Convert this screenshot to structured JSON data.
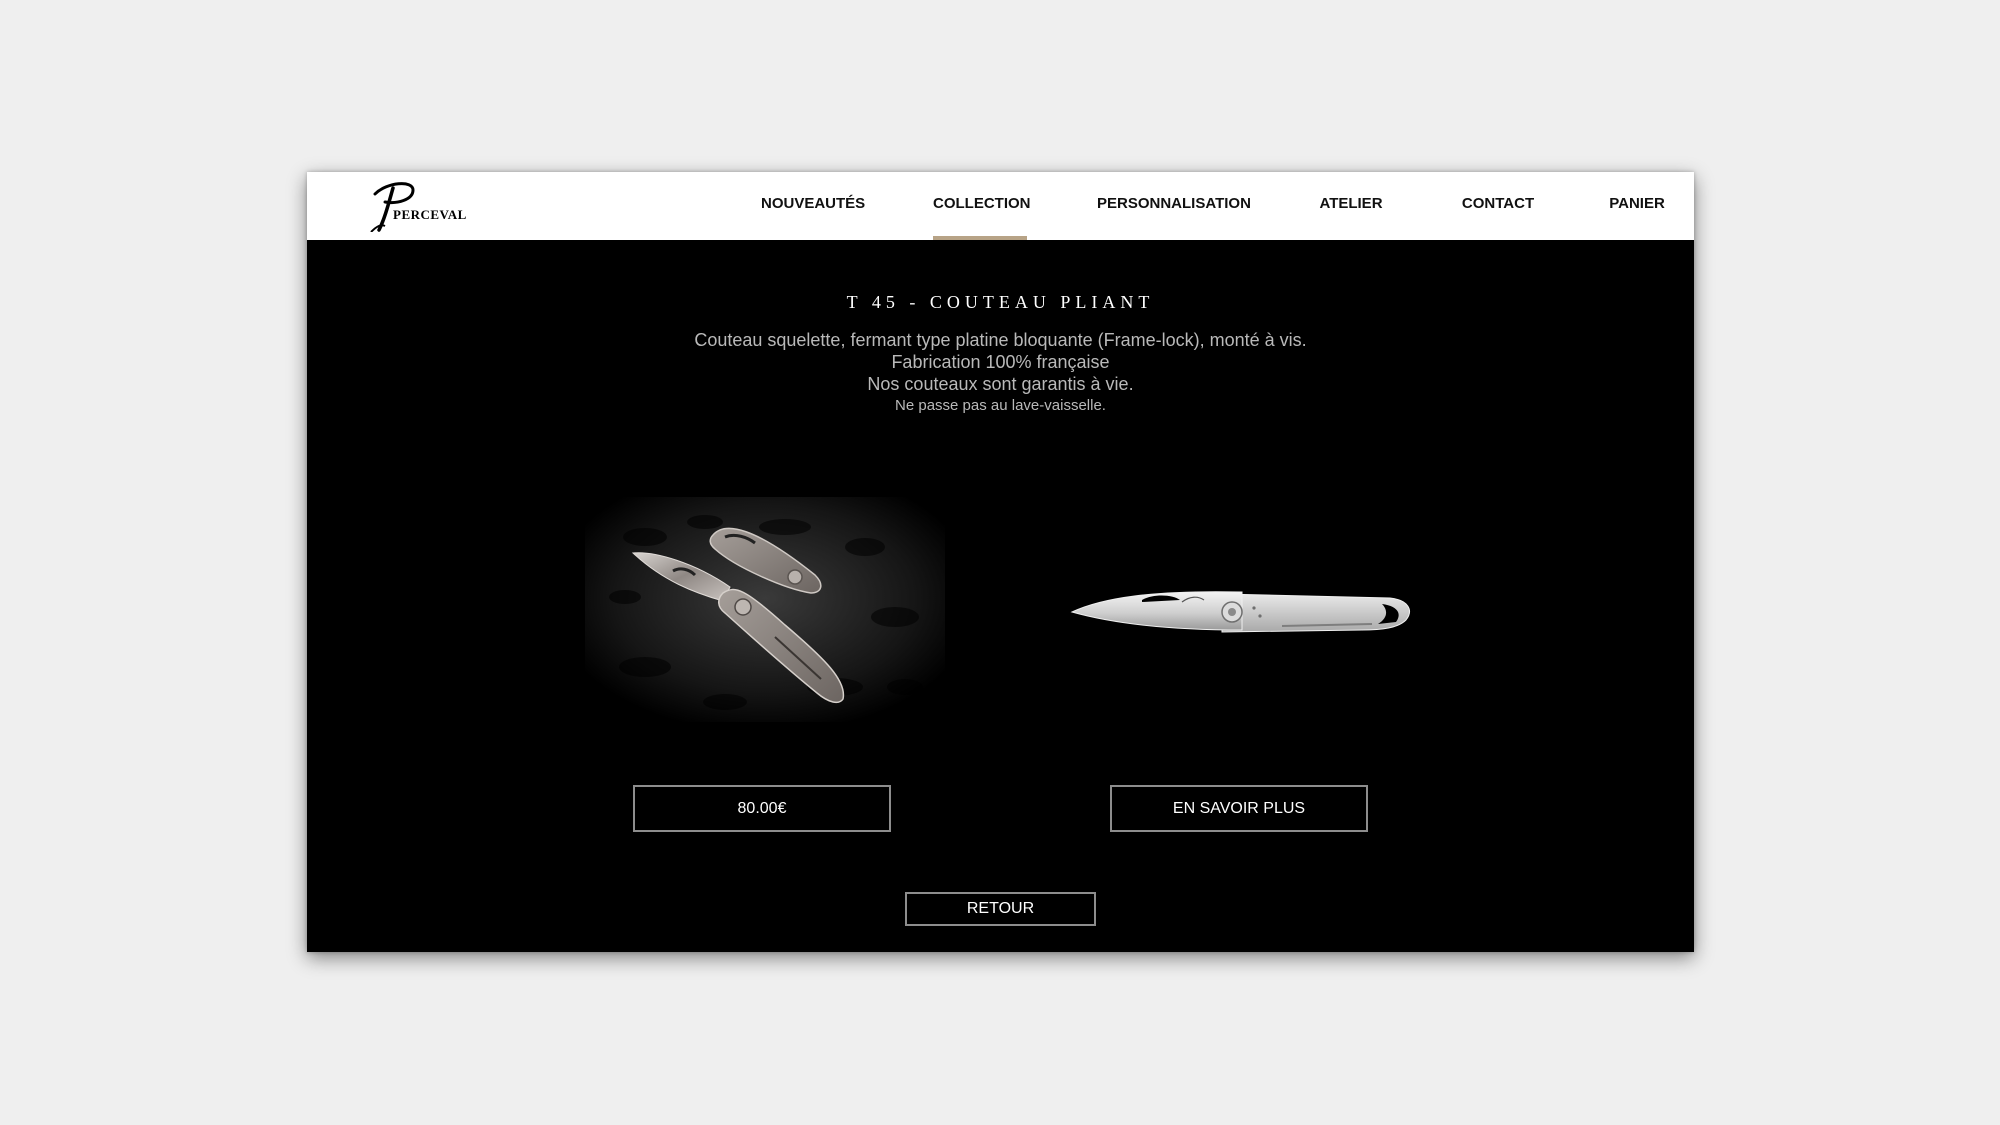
{
  "brand": {
    "logo_text": "PERCEVAL"
  },
  "nav": {
    "items": [
      {
        "label": "NOUVEAUTÉS"
      },
      {
        "label": "COLLECTION"
      },
      {
        "label": "PERSONNALISATION"
      },
      {
        "label": "ATELIER"
      },
      {
        "label": "CONTACT"
      },
      {
        "label": "PANIER"
      }
    ],
    "active": "COLLECTION",
    "accent_color": "#b7a386"
  },
  "product": {
    "title": "T 45 - COUTEAU PLIANT",
    "description": [
      "Couteau squelette, fermant type platine bloquante (Frame-lock), monté à vis.",
      "Fabrication 100% française",
      "Nos couteaux sont garantis à vie.",
      "Ne passe pas au lave-vaisselle."
    ],
    "price_label": "80.00€",
    "more_label": "EN SAVOIR PLUS",
    "back_label": "RETOUR"
  },
  "colors": {
    "page_background": "#efefef",
    "content_background": "#000000",
    "header_background": "#ffffff",
    "button_border": "#8d8d8d",
    "text_gray": "#b9b9b9"
  }
}
